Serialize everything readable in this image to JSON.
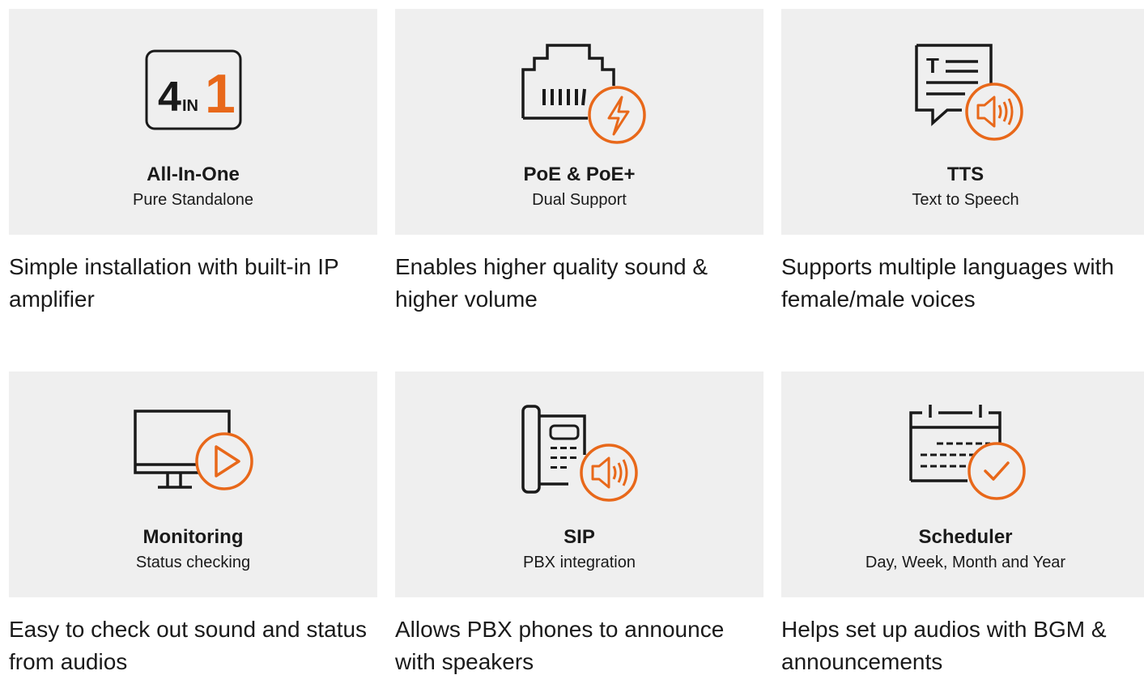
{
  "features": [
    {
      "icon": "four-in-one-icon",
      "badge_number": "4",
      "badge_in": "IN",
      "badge_one": "1",
      "title": "All-In-One",
      "subtitle": "Pure Standalone",
      "description": "Simple installation with built-in IP amplifier"
    },
    {
      "icon": "ethernet-power-icon",
      "title": "PoE & PoE+",
      "subtitle": "Dual Support",
      "description": "Enables higher quality sound & higher volume"
    },
    {
      "icon": "text-to-speech-icon",
      "badge_letter": "T",
      "title": "TTS",
      "subtitle": "Text to Speech",
      "description": "Supports multiple languages with female/male voices"
    },
    {
      "icon": "monitor-play-icon",
      "title": "Monitoring",
      "subtitle": "Status checking",
      "description": "Easy to check out sound and status from audios"
    },
    {
      "icon": "desk-phone-speaker-icon",
      "title": "SIP",
      "subtitle": "PBX integration",
      "description": "Allows PBX phones to announce with speakers"
    },
    {
      "icon": "calendar-check-icon",
      "title": "Scheduler",
      "subtitle": "Day, Week, Month and Year",
      "description": "Helps set up audios with BGM & announcements"
    }
  ],
  "colors": {
    "accent": "#e8681a",
    "icon_stroke": "#1a1a1a",
    "card_background": "#efefef"
  }
}
